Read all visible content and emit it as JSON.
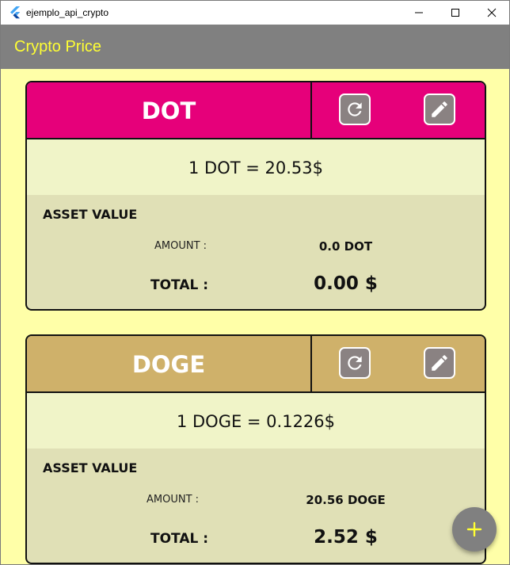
{
  "window": {
    "title": "ejemplo_api_crypto",
    "icon": "flutter-logo-icon"
  },
  "appbar": {
    "title": "Crypto Price"
  },
  "cards": [
    {
      "symbol": "DOT",
      "header_color": "#e6007a",
      "price_text": "1 DOT = 20.53$",
      "asset_title": "ASSET VALUE",
      "amount_label": "AMOUNT :",
      "amount_value": "0.0 DOT",
      "total_label": "TOTAL :",
      "total_value": "0.00 $"
    },
    {
      "symbol": "DOGE",
      "header_color": "#cfb16a",
      "price_text": "1 DOGE = 0.1226$",
      "asset_title": "ASSET VALUE",
      "amount_label": "AMOUNT :",
      "amount_value": "20.56 DOGE",
      "total_label": "TOTAL :",
      "total_value": "2.52 $"
    }
  ],
  "colors": {
    "background": "#ffffa8",
    "appbar": "#808080",
    "title_text": "#ffff33",
    "fab_icon": "#ffff33"
  },
  "fab": {
    "label": "+"
  }
}
